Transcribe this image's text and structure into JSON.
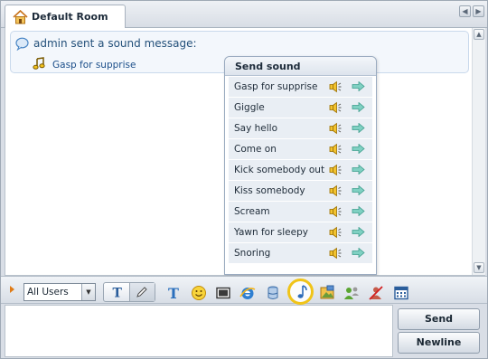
{
  "tab": {
    "title": "Default Room"
  },
  "message": {
    "header": "admin sent a sound message:",
    "sound_link": "Gasp for supprise"
  },
  "popup": {
    "title": "Send sound",
    "sounds": [
      "Gasp for supprise",
      "Giggle",
      "Say hello",
      "Come on",
      "Kick somebody out",
      "Kiss somebody",
      "Scream",
      "Yawn for sleepy",
      "Snoring"
    ]
  },
  "toolbar": {
    "user_select": "All Users",
    "icons": [
      "text-style-icon",
      "pencil-icon",
      "font-icon",
      "smiley-icon",
      "screenshot-icon",
      "ie-browser-icon",
      "database-icon",
      "music-note-icon",
      "image-icon",
      "users-icon",
      "block-user-icon",
      "calendar-icon"
    ]
  },
  "buttons": {
    "send": "Send",
    "newline": "Newline"
  },
  "colors": {
    "accent_orange": "#e07b16",
    "highlight_ring": "#f0c419",
    "link_blue": "#1c4f8a"
  }
}
